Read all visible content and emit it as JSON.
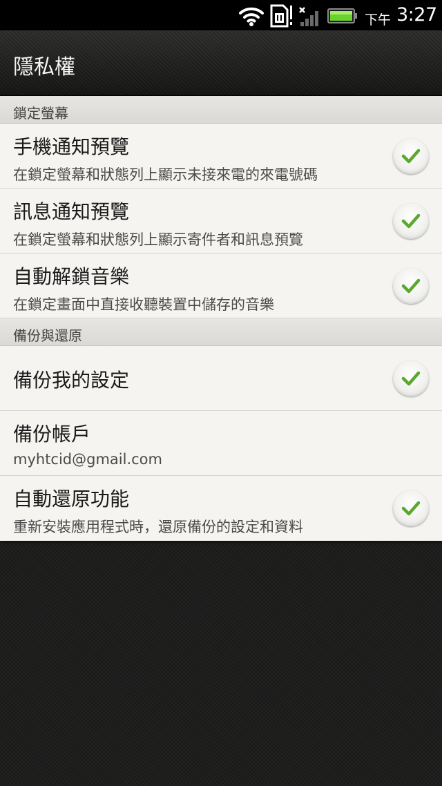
{
  "status_bar": {
    "ampm": "下午",
    "time": "3:27",
    "icons": [
      "wifi-icon",
      "sim-no-service-icon",
      "signal-icon",
      "battery-icon"
    ],
    "battery_color": "#6bd12c"
  },
  "title_bar": {
    "title": "隱私權"
  },
  "sections": [
    {
      "header": "鎖定螢幕",
      "items": [
        {
          "title": "手機通知預覽",
          "summary": "在鎖定螢幕和狀態列上顯示未接來電的來電號碼",
          "checked": true
        },
        {
          "title": "訊息通知預覽",
          "summary": "在鎖定螢幕和狀態列上顯示寄件者和訊息預覽",
          "checked": true
        },
        {
          "title": "自動解鎖音樂",
          "summary": "在鎖定畫面中直接收聽裝置中儲存的音樂",
          "checked": true
        }
      ]
    },
    {
      "header": "備份與還原",
      "items": [
        {
          "title": "備份我的設定",
          "summary": "",
          "checked": true
        },
        {
          "title": "備份帳戶",
          "summary": "myhtcid@gmail.com",
          "checked": false
        },
        {
          "title": "自動還原功能",
          "summary": "重新安裝應用程式時，還原備份的設定和資料",
          "checked": true
        }
      ]
    }
  ],
  "colors": {
    "check_green": "#5aa82c",
    "list_background": "#f5f4f1",
    "section_header_background": "#dedcd8"
  }
}
